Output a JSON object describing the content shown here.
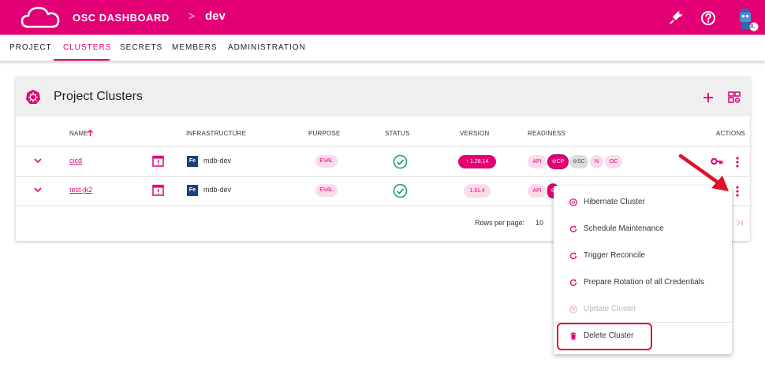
{
  "header": {
    "app_title": "OSC DASHBOARD",
    "breadcrumb_separator": ">",
    "project": "dev",
    "avatar_badge": "ZL"
  },
  "tabs": [
    {
      "label": "PROJECT"
    },
    {
      "label": "CLUSTERS"
    },
    {
      "label": "SECRETS"
    },
    {
      "label": "MEMBERS"
    },
    {
      "label": "ADMINISTRATION"
    }
  ],
  "card": {
    "title": "Project Clusters",
    "columns": {
      "name": "NAME",
      "infrastructure": "INFRASTRUCTURE",
      "purpose": "PURPOSE",
      "status": "STATUS",
      "version": "VERSION",
      "readiness": "READINESS",
      "actions": "ACTIONS"
    },
    "rows": [
      {
        "name": "cicd",
        "infra_badge": "Fe",
        "infrastructure": "mdb-dev",
        "purpose": "EVAL",
        "version": "↑ 1.28.14",
        "readiness": [
          "API",
          "⊘CP",
          "⊘SC",
          "N",
          "OC"
        ]
      },
      {
        "name": "test-jk2",
        "infra_badge": "Fe",
        "infrastructure": "mdb-dev",
        "purpose": "EVAL",
        "version": "1.31.4",
        "readiness": [
          "API",
          "⊘"
        ]
      }
    ],
    "footer": {
      "rows_per_page_label": "Rows per page:",
      "rows_per_page_value": "10"
    }
  },
  "menu": {
    "items": [
      {
        "label": "Hibernate Cluster"
      },
      {
        "label": "Schedule Maintenance"
      },
      {
        "label": "Trigger Reconcile"
      },
      {
        "label": "Prepare Rotation of all Credentials"
      },
      {
        "label": "Update Cluster"
      },
      {
        "label": "Delete Cluster"
      }
    ]
  },
  "colors": {
    "brand": "#e20074",
    "brand_light": "#fbdbeb",
    "success": "#1e9e6a",
    "highlight": "#e0112b"
  }
}
